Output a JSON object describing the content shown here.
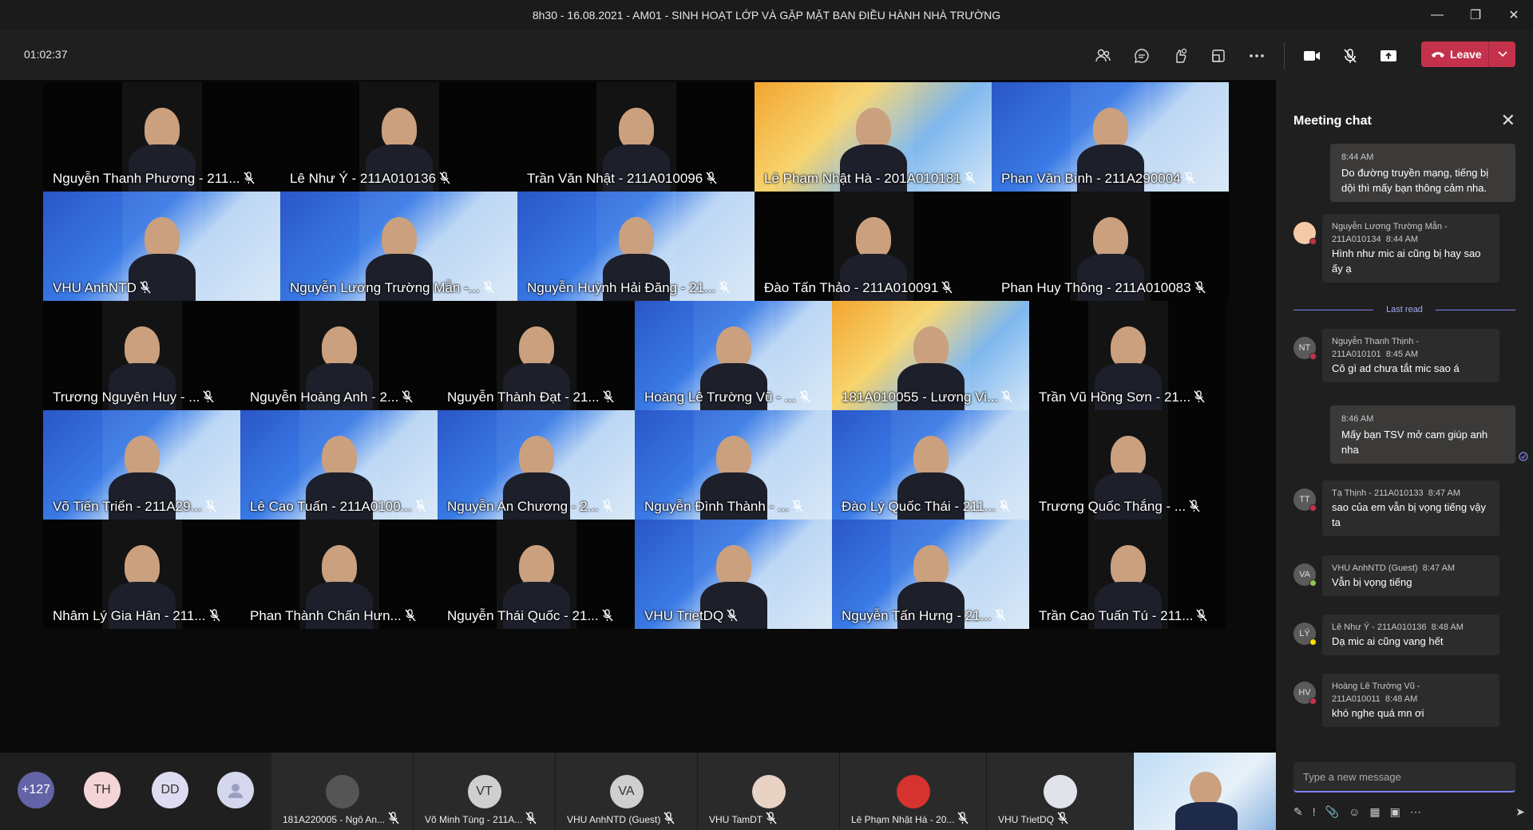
{
  "window": {
    "title": "8h30 - 16.08.2021 - AM01 - SINH HOẠT LỚP VÀ GẶP MẶT BAN ĐIỀU HÀNH NHÀ TRƯỜNG"
  },
  "toolbar": {
    "timer": "01:02:37",
    "icons": [
      "people-icon",
      "chat-icon",
      "reactions-icon",
      "rooms-icon",
      "more-icon",
      "camera-icon",
      "mic-muted-icon",
      "share-icon"
    ],
    "leave_label": "Leave"
  },
  "tiles": [
    "Nguyễn Thanh Phương - 211...",
    "Lê Như Ý - 211A010136",
    "Trần Văn Nhật - 211A010096",
    "Lê Phạm Nhật Hà - 201A010181",
    "Phan Văn Bình - 211A290004",
    "VHU AnhNTD",
    "Nguyễn Lương Trường Mẫn -...",
    "Nguyễn Huỳnh Hải Đăng - 21...",
    "Đào Tấn Thảo - 211A010091",
    "Phan Huy Thông - 211A010083",
    "Trương Nguyên Huy - ...",
    "Nguyễn Hoàng Anh - 2...",
    "Nguyễn Thành Đạt - 21...",
    "Hoàng Lê Trường Vũ - ...",
    "181A010055 - Lương Vi...",
    "Trần Vũ Hồng Sơn - 21...",
    "Võ Tiến Triển - 211A29...",
    "Lê Cao Tuấn - 211A0100...",
    "Nguyễn An Chương - 2...",
    "Nguyễn Đình Thành - ...",
    "Đào Lý Quốc Thái - 211...",
    "Trương Quốc Thắng - ...",
    "Nhâm Lý Gia Hân - 211...",
    "Phan Thành Chấn Hưn...",
    "Nguyễn Thái Quốc - 21...",
    "VHU TrietDQ",
    "Nguyễn Tấn Hưng - 21...",
    "Trần Cao Tuấn Tú - 211..."
  ],
  "roster": {
    "overflow": "+127",
    "bubbles": [
      "TH",
      "DD"
    ],
    "tiles": [
      {
        "name": "181A220005 - Ngô An...",
        "initials": ""
      },
      {
        "name": "Võ Minh Tùng - 211A...",
        "initials": "VT"
      },
      {
        "name": "VHU AnhNTD (Guest)",
        "initials": "VA"
      },
      {
        "name": "VHU TamDT",
        "initials": ""
      },
      {
        "name": "Lê Phạm Nhật Hà - 20...",
        "initials": ""
      },
      {
        "name": "VHU TrietDQ",
        "initials": ""
      }
    ]
  },
  "chat": {
    "title": "Meeting chat",
    "last_read": "Last read",
    "placeholder": "Type a new message",
    "messages": [
      {
        "own": true,
        "time": "8:44 AM",
        "text": "Do đường truyền mạng, tiếng bị dội thì mấy bạn thông cảm nha."
      },
      {
        "own": false,
        "initials": "",
        "author": "Nguyễn Lương Trường Mẫn - 211A010134",
        "time": "8:44 AM",
        "text": "Hình như mic ai cũng bị hay sao ấy ạ"
      },
      {
        "own": false,
        "initials": "NT",
        "author": "Nguyễn Thanh Thịnh - 211A010101",
        "time": "8:45 AM",
        "text": "Cô gì ad chưa tắt mic sao á"
      },
      {
        "own": true,
        "time": "8:46 AM",
        "text": "Mấy bạn TSV mở cam giúp anh nha"
      },
      {
        "own": false,
        "initials": "TT",
        "author": "Tạ Thịnh - 211A010133",
        "time": "8:47 AM",
        "text": "sao của em vẫn bị vọng tiếng vậy ta"
      },
      {
        "own": false,
        "initials": "VA",
        "author": "VHU AnhNTD (Guest)",
        "time": "8:47 AM",
        "text": "Vẫn bị vọng tiếng"
      },
      {
        "own": false,
        "initials": "LÝ",
        "author": "Lê Như Ý - 211A010136",
        "time": "8:48 AM",
        "text": "Dạ mic ai cũng vang hết"
      },
      {
        "own": false,
        "initials": "HV",
        "author": "Hoàng Lê Trường Vũ - 211A010011",
        "time": "8:48 AM",
        "text": "khó nghe quá mn ơi"
      }
    ]
  },
  "colors": {
    "leave": "#c4314b",
    "accent": "#7f85f5",
    "panel": "#1f1f1f"
  }
}
